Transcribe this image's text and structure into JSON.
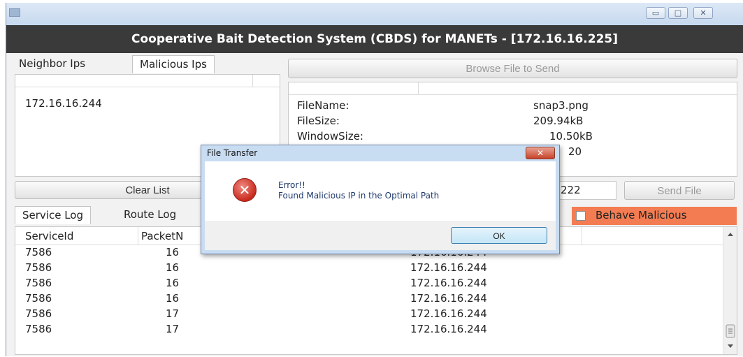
{
  "window": {
    "title": "Cooperative Bait Detection System (CBDS) for MANETs - [172.16.16.225]",
    "minimize_glyph": "▭",
    "maximize_glyph": "□",
    "close_glyph": "✕"
  },
  "left_tabs": [
    "Neighbor Ips",
    "Malicious Ips"
  ],
  "malicious_ips": [
    "172.16.16.244"
  ],
  "clear_list_label": "Clear List",
  "browse_label": "Browse File to Send",
  "file_info": {
    "filename_label": "FileName:",
    "filename_value": "snap3.png",
    "filesize_label": "FileSize:",
    "filesize_value": "209.94kB",
    "windowsize_label": "WindowSize:",
    "windowsize_value": "10.50kB",
    "packets_value": "20"
  },
  "destination_partial": "222",
  "send_file_label": "Send File",
  "log_tabs": [
    "Service Log",
    "Route Log"
  ],
  "behave_malicious_label": "Behave Malicious",
  "log_table": {
    "headers": [
      "ServiceId",
      "PacketN"
    ],
    "rows": [
      {
        "service_id": "7586",
        "packet": "16",
        "ip": "172.16.16.244"
      },
      {
        "service_id": "7586",
        "packet": "16",
        "ip": "172.16.16.244"
      },
      {
        "service_id": "7586",
        "packet": "16",
        "ip": "172.16.16.244"
      },
      {
        "service_id": "7586",
        "packet": "16",
        "ip": "172.16.16.244"
      },
      {
        "service_id": "7586",
        "packet": "17",
        "ip": "172.16.16.244"
      },
      {
        "service_id": "7586",
        "packet": "17",
        "ip": "172.16.16.244"
      }
    ]
  },
  "dialog": {
    "title": "File Transfer",
    "close_glyph": "✕",
    "icon_glyph": "✕",
    "line1": "Error!!",
    "line2": "Found Malicious IP in the Optimal Path",
    "ok_label": "OK"
  },
  "colors": {
    "title_bg": "#3a3a3a",
    "behave_bg": "#f47c52",
    "error_red": "#c92a1e"
  },
  "icons": {
    "app": "app-icon",
    "error": "error-icon",
    "scroll_up": "scroll-up-arrow-icon",
    "scroll_down": "scroll-down-arrow-icon"
  }
}
